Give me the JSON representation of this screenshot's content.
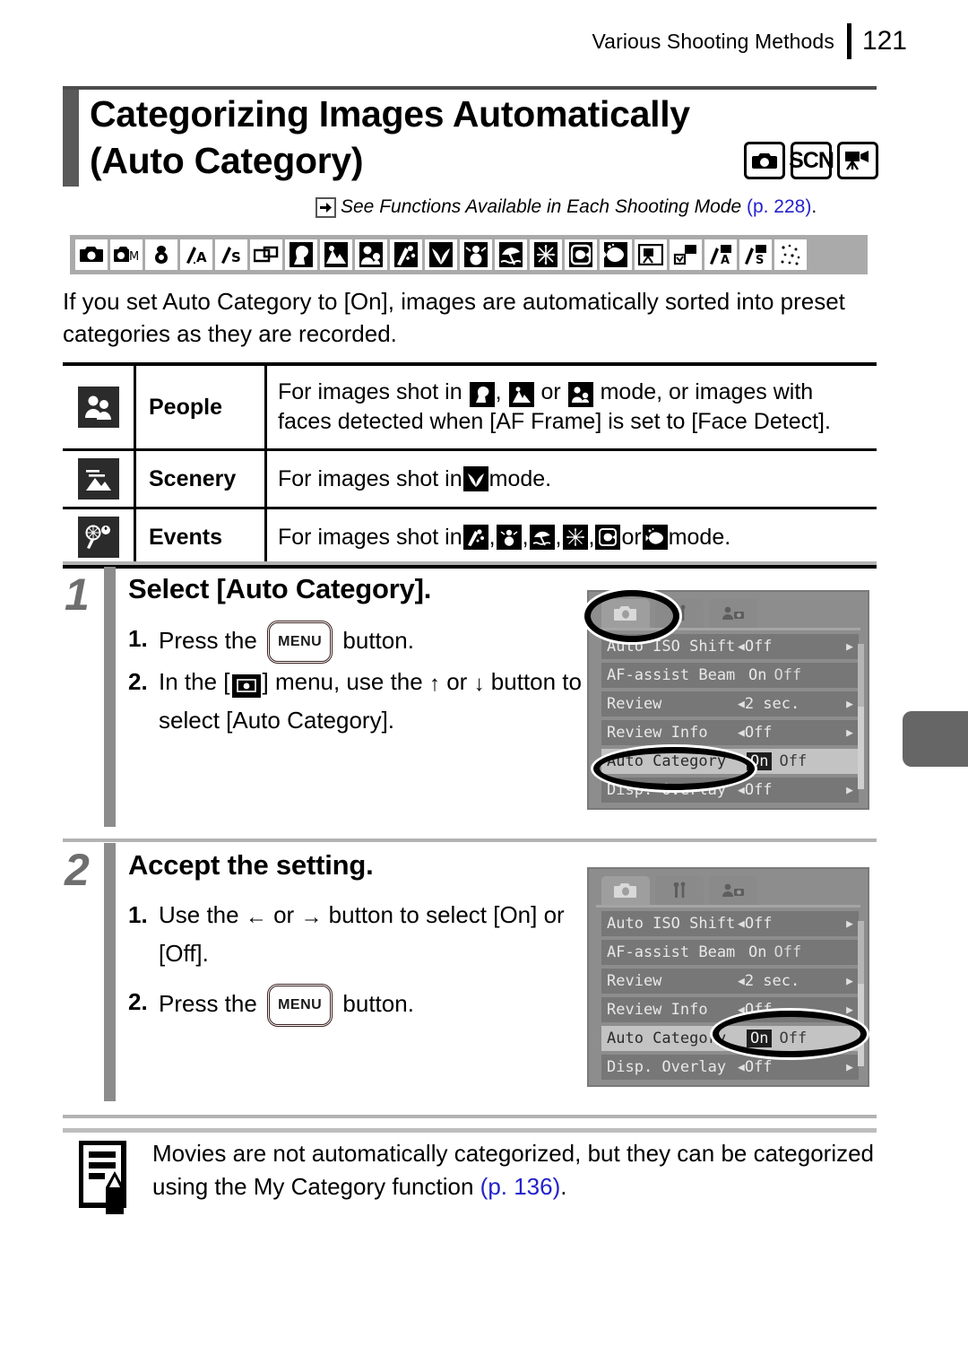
{
  "header": {
    "chapter": "Various Shooting Methods",
    "page_number": "121"
  },
  "title": {
    "line1": "Categorizing Images Automatically",
    "line2": "(Auto Category)",
    "mode_badges": [
      {
        "name": "camera-mode-badge",
        "label": ""
      },
      {
        "name": "scn-mode-badge",
        "label": "SCN"
      },
      {
        "name": "movie-mode-badge",
        "label": ""
      }
    ]
  },
  "see_also": {
    "icon": "arrow-right-icon",
    "text": "See Functions Available in Each Shooting Mode",
    "page_ref": "(p. 228)",
    "trailing": "."
  },
  "mode_strip": [
    "auto-mode-icon",
    "manual-mode-icon",
    "digital-macro-icon",
    "stitch-assist-a-icon",
    "stitch-assist-s-icon",
    "aspect-icon",
    "portrait-icon",
    "night-snapshot-icon",
    "kids-and-pets-icon",
    "indoor-icon",
    "foliage-icon",
    "snow-icon",
    "beach-icon",
    "fireworks-icon",
    "aquarium-icon",
    "underwater-icon",
    "movie-standard-icon",
    "movie-compact-icon",
    "movie-stitch-a-icon",
    "movie-stitch-s-icon",
    "color-accent-icon"
  ],
  "intro": "If you set Auto Category to [On], images are automatically sorted into preset categories as they are recorded.",
  "category_table": {
    "rows": [
      {
        "icon": "people-category-icon",
        "name": "People",
        "desc_part1": "For images shot in",
        "mode_icons": [
          "portrait-icon",
          "night-snapshot-icon",
          "kids-and-pets-icon"
        ],
        "desc_sep1": ",",
        "desc_sep2": "or",
        "desc_part2": "mode, or images with",
        "desc_part3": "faces detected when [AF Frame] is set to [Face Detect]."
      },
      {
        "icon": "scenery-category-icon",
        "name": "Scenery",
        "desc_part1": "For images shot in",
        "mode_icons": [
          "foliage-icon"
        ],
        "desc_part2": "mode."
      },
      {
        "icon": "events-category-icon",
        "name": "Events",
        "desc_part1": "For images shot in",
        "mode_icons": [
          "indoor-icon",
          "snow-icon",
          "beach-icon",
          "fireworks-icon",
          "aquarium-icon",
          "underwater-icon"
        ],
        "desc_sep": ",",
        "desc_or": "or",
        "desc_part2": "mode."
      }
    ]
  },
  "steps": [
    {
      "number": "1",
      "heading": "Select [Auto Category].",
      "items": [
        {
          "index": "1.",
          "pre": "Press the",
          "button": "MENU",
          "post": "button."
        },
        {
          "index": "2.",
          "pre": "In the [",
          "icon": "rec-menu-icon",
          "mid": "] menu, use the",
          "up": "↑",
          "or": "or",
          "down": "↓",
          "post": "button to select [Auto Category]."
        }
      ]
    },
    {
      "number": "2",
      "heading": "Accept the setting.",
      "items": [
        {
          "index": "1.",
          "pre": "Use the",
          "left": "←",
          "or": "or",
          "right": "→",
          "post": "button to select [On] or [Off]."
        },
        {
          "index": "2.",
          "pre": "Press the",
          "button": "MENU",
          "post": "button."
        }
      ]
    }
  ],
  "lcd_screens": [
    {
      "name": "lcd-screen-step1",
      "tabs": [
        "rec-tab-icon",
        "setup-tab-icon",
        "mycamera-tab-icon"
      ],
      "active_tab": 0,
      "rows": [
        {
          "label": "Auto ISO Shift",
          "value": "Off",
          "type": "spin"
        },
        {
          "label": "AF-assist Beam",
          "value_on": "On",
          "value_off": "Off",
          "type": "toggle",
          "selected": "Off"
        },
        {
          "label": "Review",
          "value": "2 sec.",
          "type": "spin"
        },
        {
          "label": "Review Info",
          "value": "Off",
          "type": "spin"
        },
        {
          "label": "Auto Category",
          "value_on": "On",
          "value_off": "Off",
          "type": "toggle",
          "selected": "On",
          "highlighted": true
        },
        {
          "label": "Disp. Overlay",
          "value": "Off",
          "type": "spin"
        }
      ],
      "callout_target": "label"
    },
    {
      "name": "lcd-screen-step2",
      "tabs": [
        "rec-tab-icon",
        "setup-tab-icon",
        "mycamera-tab-icon"
      ],
      "active_tab": 0,
      "rows": [
        {
          "label": "Auto ISO Shift",
          "value": "Off",
          "type": "spin"
        },
        {
          "label": "AF-assist Beam",
          "value_on": "On",
          "value_off": "Off",
          "type": "toggle",
          "selected": "Off"
        },
        {
          "label": "Review",
          "value": "2 sec.",
          "type": "spin"
        },
        {
          "label": "Review Info",
          "value": "Off",
          "type": "spin"
        },
        {
          "label": "Auto Category",
          "value_on": "On",
          "value_off": "Off",
          "type": "toggle",
          "selected": "On",
          "highlighted": true
        },
        {
          "label": "Disp. Overlay",
          "value": "Off",
          "type": "spin"
        }
      ],
      "callout_target": "value"
    }
  ],
  "note": {
    "icon": "note-pencil-icon",
    "text": "Movies are not automatically categorized, but they can be categorized using the My Category function",
    "page_ref": "(p. 136)",
    "trailing": "."
  },
  "colors": {
    "link": "#2222cc",
    "title_bar": "#595959",
    "step_bar": "#8c8c8c",
    "step_number": "#6e6e6e",
    "mode_strip_bg": "#aaaaaa",
    "lcd_bg": "#8d8d8d",
    "lcd_row": "#777777",
    "lcd_row_selected": "#c3c3c3",
    "edge_tab": "#666666"
  }
}
